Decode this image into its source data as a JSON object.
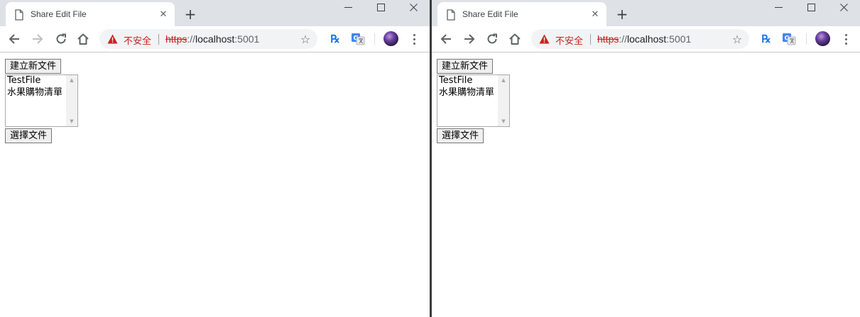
{
  "windows": [
    {
      "tab": {
        "title": "Share Edit File",
        "close_glyph": "✕"
      },
      "new_tab_glyph": "+",
      "window_controls": {
        "minimize": "—",
        "maximize": "☐",
        "close": "✕"
      },
      "omnibox": {
        "security_label": "不安全",
        "url": {
          "scheme": "https",
          "separator": "://",
          "host": "localhost",
          "port": ":5001"
        }
      },
      "extension_rx_label": "℞",
      "page": {
        "create_button_label": "建立新文件",
        "list_options": [
          "TestFile",
          "水果購物清單"
        ],
        "select_button_label": "選擇文件"
      }
    },
    {
      "tab": {
        "title": "Share Edit File",
        "close_glyph": "✕"
      },
      "new_tab_glyph": "+",
      "window_controls": {
        "minimize": "—",
        "maximize": "☐",
        "close": "✕"
      },
      "omnibox": {
        "security_label": "不安全",
        "url": {
          "scheme": "https",
          "separator": "://",
          "host": "localhost",
          "port": ":5001"
        }
      },
      "extension_rx_label": "℞",
      "page": {
        "create_button_label": "建立新文件",
        "list_options": [
          "TestFile",
          "水果購物清單"
        ],
        "select_button_label": "選擇文件"
      }
    }
  ],
  "icons": {
    "back": "arrow-left-icon",
    "forward": "arrow-right-icon",
    "reload": "reload-icon",
    "home": "home-icon",
    "warning": "warning-triangle-icon",
    "bookmark": "star-icon",
    "rx_extension": "rx-extension-icon",
    "translate": "translate-icon",
    "profile": "avatar",
    "menu": "kebab-menu-icon",
    "page": "page-icon"
  },
  "colors": {
    "tabstrip": "#dee1e6",
    "insecure_red": "#c5221f",
    "extension_blue": "#1a73e8",
    "toolbar_icon": "#5f6368",
    "button_face": "#efefef"
  }
}
